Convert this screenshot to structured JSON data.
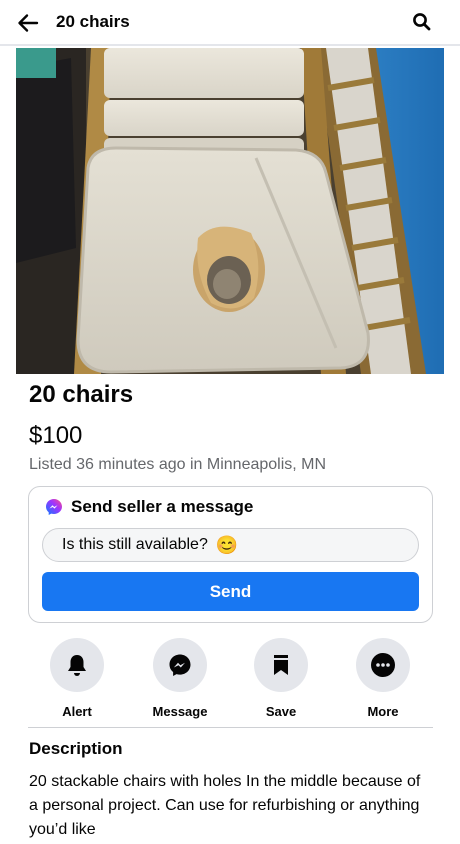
{
  "header": {
    "title": "20 chairs",
    "back_icon": "arrow-left-icon",
    "search_icon": "search-icon"
  },
  "listing": {
    "photo_description_icon": "listing-photo",
    "title": "20 chairs",
    "price": "$100",
    "meta": "Listed 36 minutes ago in Minneapolis, MN"
  },
  "message_card": {
    "icon": "messenger-icon",
    "heading": "Send seller a message",
    "input_value": "Is this still available?",
    "emoji": "😊",
    "send_label": "Send"
  },
  "actions": [
    {
      "label": "Alert",
      "icon": "bell-icon"
    },
    {
      "label": "Message",
      "icon": "messenger-icon"
    },
    {
      "label": "Save",
      "icon": "bookmark-icon"
    },
    {
      "label": "More",
      "icon": "more-icon"
    }
  ],
  "description": {
    "heading": "Description",
    "body": "20 stackable chairs with holes In the middle because of a personal project. Can use for refurbishing or anything you’d like"
  },
  "colors": {
    "accent": "#1877f2",
    "secondary_text": "#65676b",
    "circle_bg": "#e4e6eb"
  }
}
